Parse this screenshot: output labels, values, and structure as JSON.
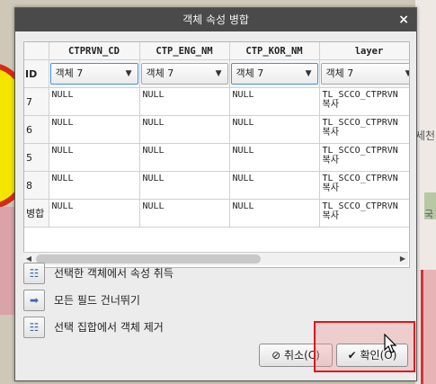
{
  "window": {
    "title": "객체 속성 병합",
    "close_glyph": "×"
  },
  "table": {
    "columns": [
      "CTPRVN_CD",
      "CTP_ENG_NM",
      "CTP_KOR_NM",
      "layer"
    ],
    "id_header": "ID",
    "combo_value": "객체 7",
    "rows": [
      {
        "id": "7",
        "cells": [
          "NULL",
          "NULL",
          "NULL",
          "TL_SCCO_CTPRVN\n복사"
        ]
      },
      {
        "id": "6",
        "cells": [
          "NULL",
          "NULL",
          "NULL",
          "TL_SCCO_CTPRVN\n복사"
        ]
      },
      {
        "id": "5",
        "cells": [
          "NULL",
          "NULL",
          "NULL",
          "TL_SCCO_CTPRVN\n복사"
        ]
      },
      {
        "id": "8",
        "cells": [
          "NULL",
          "NULL",
          "NULL",
          "TL_SCCO_CTPRVN\n복사"
        ]
      },
      {
        "id": "병합",
        "cells": [
          "NULL",
          "NULL",
          "NULL",
          "TL_SCCO_CTPRVN\n복사"
        ]
      }
    ]
  },
  "actions": [
    {
      "label": "선택한 객체에서 속성 취득",
      "icon": "table-icon"
    },
    {
      "label": "모든 필드 건너뛰기",
      "icon": "arrow-right-icon"
    },
    {
      "label": "선택 집합에서 객체 제거",
      "icon": "remove-selection-icon"
    }
  ],
  "buttons": {
    "cancel": "취소(C)",
    "ok": "확인(O)"
  },
  "map_text": {
    "a": "세천",
    "b": "국"
  }
}
